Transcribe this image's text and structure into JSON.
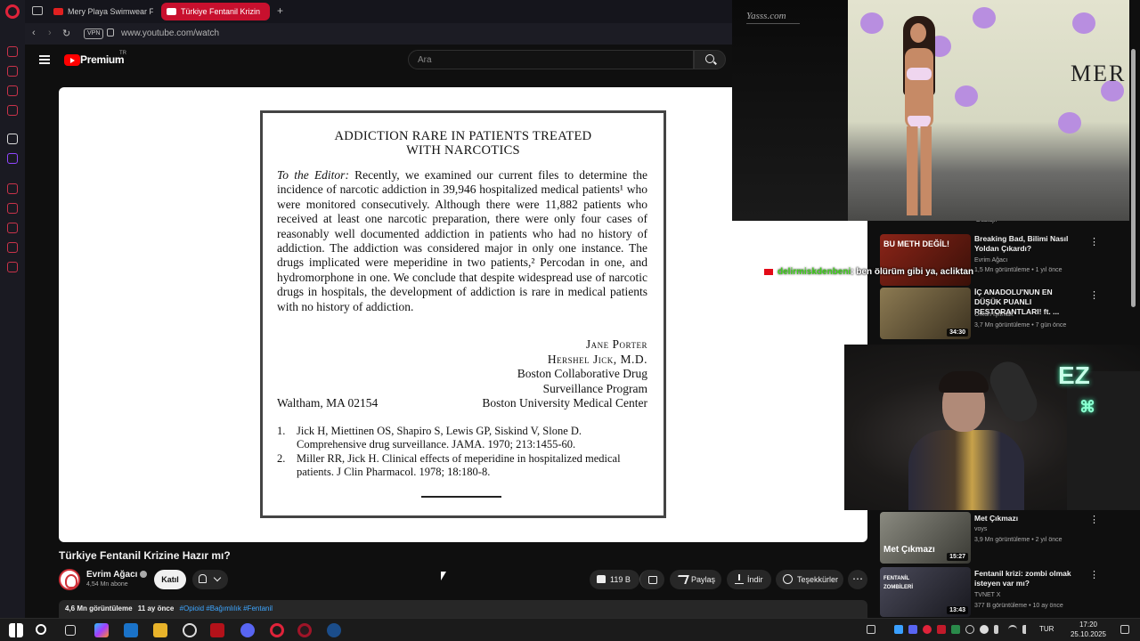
{
  "browser": {
    "tabs": [
      {
        "label": "Mery Playa Swimwear Fa",
        "active": false
      },
      {
        "label": "Türkiye Fentanil Krizin",
        "active": true
      }
    ],
    "vpn_label": "VPN",
    "url": "www.youtube.com/watch"
  },
  "youtube": {
    "premium_label": "Premium",
    "premium_region": "TR",
    "search_placeholder": "Ara"
  },
  "letter": {
    "title_line1": "ADDICTION RARE IN PATIENTS TREATED",
    "title_line2": "WITH NARCOTICS",
    "salutation": "To the Editor:",
    "body": "Recently, we examined our current files to determine the incidence of narcotic addiction in 39,946 hospitalized medical patients¹ who were monitored consecutively. Although there were 11,882 patients who received at least one narcotic preparation, there were only four cases of reasonably well documented addiction in patients who had no history of addiction. The addiction was considered major in only one instance. The drugs implicated were meperidine in two patients,² Percodan in one, and hydromorphone in one. We conclude that despite widespread use of narcotic drugs in hospitals, the development of addiction is rare in medical patients with no history of addiction.",
    "signers": [
      "Jane Porter",
      "Hershel Jick, M.D."
    ],
    "affiliation_line1": "Boston Collaborative Drug",
    "affiliation_line2": "Surveillance Program",
    "location": "Waltham, MA 02154",
    "institution": "Boston University Medical Center",
    "references": [
      {
        "num": "1.",
        "text": "Jick H, Miettinen OS, Shapiro S, Lewis GP, Siskind V, Slone D. Comprehensive drug surveillance. JAMA. 1970; 213:1455-60."
      },
      {
        "num": "2.",
        "text": "Miller RR, Jick H. Clinical effects of meperidine in hospitalized medical patients. J Clin Pharmacol. 1978; 18:180-8."
      }
    ]
  },
  "video": {
    "title": "Türkiye Fentanil Krizine Hazır mı?",
    "channel": "Evrim Ağacı",
    "subscribers": "4,54 Mn abone",
    "join_label": "Katıl",
    "likes": "119 B",
    "share_label": "Paylaş",
    "download_label": "İndir",
    "thanks_label": "Teşekkürler",
    "more_label": "⋯",
    "views": "4,6 Mn görüntüleme",
    "age": "11 ay önce",
    "hashtags": "#Opioid #Bağımlılık #Fentanil"
  },
  "recommendations": {
    "dubbed_label": "Dublajlı",
    "items": [
      {
        "title": "Breaking Bad, Bilimi Nasıl Yoldan Çıkardı?",
        "channel": "Evrim Ağacı",
        "meta": "1,5 Mn görüntüleme • 1 yıl önce",
        "thumb_text": "BU METH DEĞİL!",
        "duration": "",
        "thumb_color": "#7a1c14"
      },
      {
        "title": "İÇ ANADOLU'NUN EN DÜŞÜK PUANLI RESTORANTLARI! ft. ...",
        "channel": "Orkun Işıtmak",
        "meta": "3,7 Mn görüntüleme • 7 gün önce",
        "thumb_text": "",
        "duration": "34:30",
        "thumb_color": "#6b5a3a"
      },
      {
        "title": "Met Çıkmazı",
        "channel": "voys",
        "meta": "3,9 Mn görüntüleme • 2 yıl önce",
        "thumb_text": "Met Çıkmazı",
        "duration": "15:27",
        "thumb_color": "#5a5a52"
      },
      {
        "title": "Fentanil krizi: zombi olmak isteyen var mı?",
        "channel": "TVNET X",
        "meta": "377 B görüntüleme • 10 ay önce",
        "thumb_text": "FENTANİL ZOMBİLERİ",
        "duration": "13:43",
        "thumb_color": "#3a3a44"
      }
    ]
  },
  "promo": {
    "logo_text": "Yasss.com",
    "brand_text": "MER"
  },
  "chat": {
    "username": "delirmiskdenbeni",
    "message": ": ben ölürüm gibi ya, acliktan"
  },
  "webcam": {
    "neon_text": "EZ"
  },
  "taskbar": {
    "language": "TUR",
    "time": "17:20",
    "date": "25.10.2025"
  },
  "colors": {
    "accent": "#ff0000",
    "opera": "#e0233a",
    "link": "#3ea6ff"
  }
}
